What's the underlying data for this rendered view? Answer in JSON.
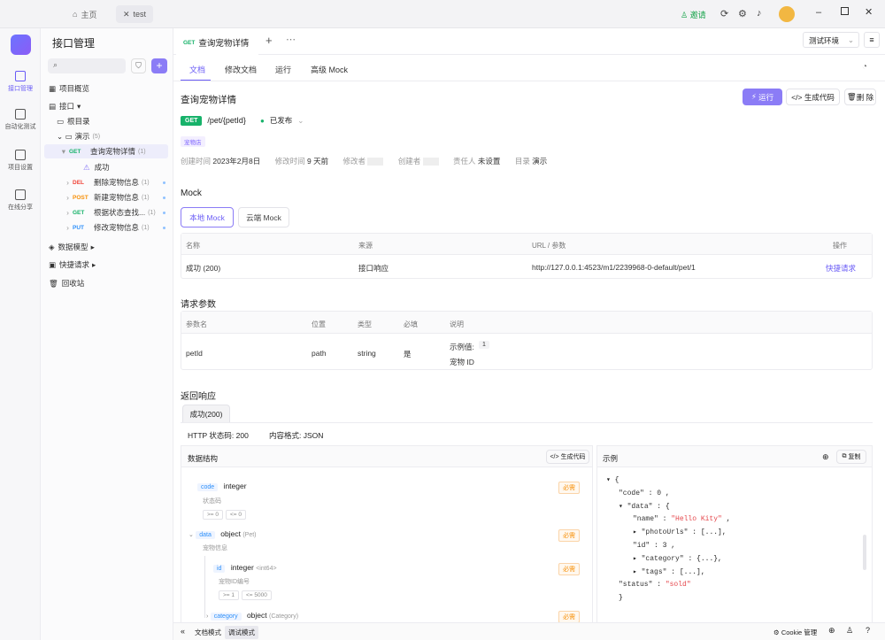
{
  "titlebar": {
    "home": "主页",
    "tab": "test",
    "invite": "邀请"
  },
  "rail": [
    "接口管理",
    "自动化测试",
    "项目设置",
    "在线分享"
  ],
  "sidebar": {
    "title": "接口管理",
    "overview": "项目概览",
    "api": "接口",
    "root": "根目录",
    "demo": "演示",
    "demo_count": "(5)",
    "items": [
      {
        "method": "GET",
        "label": "查询宠物详情",
        "count": "(1)"
      },
      {
        "label": "成功"
      },
      {
        "method": "DEL",
        "label": "删除宠物信息",
        "count": "(1)"
      },
      {
        "method": "POST",
        "label": "新建宠物信息",
        "count": "(1)"
      },
      {
        "method": "GET",
        "label": "根据状态查找...",
        "count": "(1)"
      },
      {
        "method": "PUT",
        "label": "修改宠物信息",
        "count": "(1)"
      }
    ],
    "models": "数据模型",
    "quick": "快捷请求",
    "trash": "回收站"
  },
  "tab": {
    "method": "GET",
    "title": "查询宠物详情"
  },
  "env": "测试环境",
  "subtabs": [
    "文档",
    "修改文档",
    "运行",
    "高级 Mock"
  ],
  "api": {
    "name": "查询宠物详情",
    "method": "GET",
    "path": "/pet/{petId}",
    "status": "已发布",
    "tag": "宠物店",
    "meta": [
      [
        "创建时间",
        "2023年2月8日"
      ],
      [
        "修改时间",
        "9 天前"
      ],
      [
        "修改者",
        ""
      ],
      [
        "创建者",
        ""
      ],
      [
        "责任人",
        "未设置"
      ],
      [
        "目录",
        "演示"
      ]
    ]
  },
  "buttons": {
    "run": "运行",
    "gen": "生成代码",
    "del": "删 除"
  },
  "mock": {
    "title": "Mock",
    "local": "本地 Mock",
    "cloud": "云端 Mock",
    "headers": [
      "名称",
      "来源",
      "URL / 参数",
      "操作"
    ],
    "row": [
      "成功 (200)",
      "接口响应",
      "http://127.0.0.1:4523/m1/2239968-0-default/pet/1",
      "快捷请求"
    ]
  },
  "params": {
    "title": "请求参数",
    "headers": [
      "参数名",
      "位置",
      "类型",
      "必填",
      "说明"
    ],
    "row": [
      "petId",
      "path",
      "string",
      "是"
    ],
    "example_label": "示例值:",
    "example": "1",
    "desc": "宠物 ID"
  },
  "response": {
    "title": "返回响应",
    "tab": "成功(200)",
    "http": "HTTP 状态码: 200",
    "format": "内容格式: JSON",
    "schema_title": "数据结构",
    "gen": "生成代码",
    "example_title": "示例",
    "copy": "复制",
    "fields": [
      {
        "name": "code",
        "type": "integer",
        "desc": "状态码",
        "req": "必需",
        "ranges": [
          ">= 0",
          "<= 0"
        ]
      },
      {
        "name": "data",
        "type": "object",
        "sub": "(Pet)",
        "desc": "宠物信息",
        "req": "必需"
      },
      {
        "name": "id",
        "type": "integer",
        "sub": "<int64>",
        "desc": "宠物ID编号",
        "req": "必需",
        "ranges": [
          ">= 1",
          "<= 5000"
        ]
      },
      {
        "name": "category",
        "type": "object",
        "sub": "(Category)",
        "req": "必需"
      }
    ]
  },
  "footer": {
    "doc": "文档模式",
    "debug": "调试模式",
    "cookie": "Cookie 管理"
  }
}
